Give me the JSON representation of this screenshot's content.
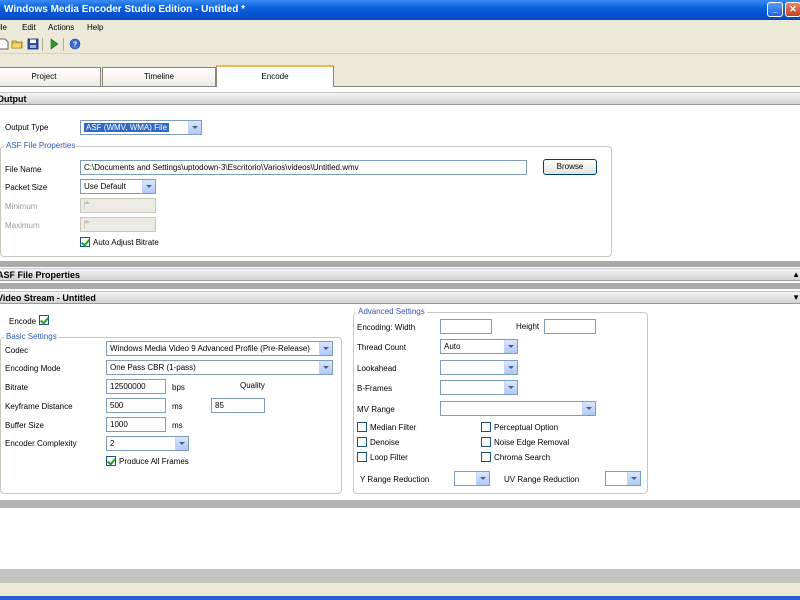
{
  "window": {
    "title": "Windows Media Encoder Studio Edition - Untitled  *",
    "minimize_glyph": "_",
    "close_glyph": "✕"
  },
  "menu": [
    "ile",
    "Edit",
    "Actions",
    "Help"
  ],
  "toolbar": {
    "icons": [
      "new-icon",
      "open-folder-icon",
      "save-icon",
      "start-encoding-icon",
      "help-icon"
    ]
  },
  "tabs": [
    {
      "label": "Project",
      "active": false
    },
    {
      "label": "Timeline",
      "active": false
    },
    {
      "label": "Encode",
      "active": true
    }
  ],
  "output": {
    "section_title": "Output",
    "output_type_label": "Output Type",
    "output_type_value": "ASF (WMV, WMA) File",
    "group_title": "ASF File Properties",
    "file_name_label": "File Name",
    "file_name_value": "C:\\Documents and Settings\\uptodown-3\\Escritorio\\Varios\\videos\\Untitled.wmv",
    "browse_label": "Browse",
    "packet_size_label": "Packet Size",
    "packet_size_value": "Use Default",
    "minimum_label": "Minimum",
    "maximum_label": "Maximum",
    "auto_adjust_label": "Auto Adjust Bitrate",
    "auto_adjust_checked": true
  },
  "asf_section": {
    "title": "ASF File Properties",
    "arrow": "▲"
  },
  "video_stream": {
    "title": "Video Stream - Untitled",
    "arrow": "▼",
    "encode_label": "Encode",
    "encode_checked": true,
    "basic": {
      "group_title": "Basic Settings",
      "codec_label": "Codec",
      "codec_value": "Windows Media Video 9 Advanced Profile (Pre-Release)",
      "encoding_mode_label": "Encoding Mode",
      "encoding_mode_value": "One Pass CBR (1-pass)",
      "bitrate_label": "Bitrate",
      "bitrate_value": "12500000",
      "bitrate_unit": "bps",
      "quality_label": "Quality",
      "quality_value": "85",
      "keyframe_label": "Keyframe Distance",
      "keyframe_value": "500",
      "keyframe_unit": "ms",
      "buffer_label": "Buffer Size",
      "buffer_value": "1000",
      "buffer_unit": "ms",
      "complexity_label": "Encoder Complexity",
      "complexity_value": "2",
      "produce_all_frames_label": "Produce All Frames",
      "produce_all_frames_checked": true
    },
    "advanced": {
      "group_title": "Advanced Settings",
      "encoding_width_label": "Encoding: Width",
      "encoding_width_value": "",
      "height_label": "Height",
      "height_value": "",
      "thread_count_label": "Thread Count",
      "thread_count_value": "Auto",
      "lookahead_label": "Lookahead",
      "lookahead_value": "",
      "bframes_label": "B-Frames",
      "bframes_value": "",
      "mv_range_label": "MV Range",
      "mv_range_value": "",
      "median_filter_label": "Median Filter",
      "perceptual_option_label": "Perceptual Option",
      "denoise_label": "Denoise",
      "noise_edge_removal_label": "Noise Edge Removal",
      "loop_filter_label": "Loop Filter",
      "chroma_search_label": "Chroma Search",
      "y_range_label": "Y Range Reduction",
      "y_range_value": "",
      "uv_range_label": "UV Range Reduction",
      "uv_range_value": ""
    }
  }
}
